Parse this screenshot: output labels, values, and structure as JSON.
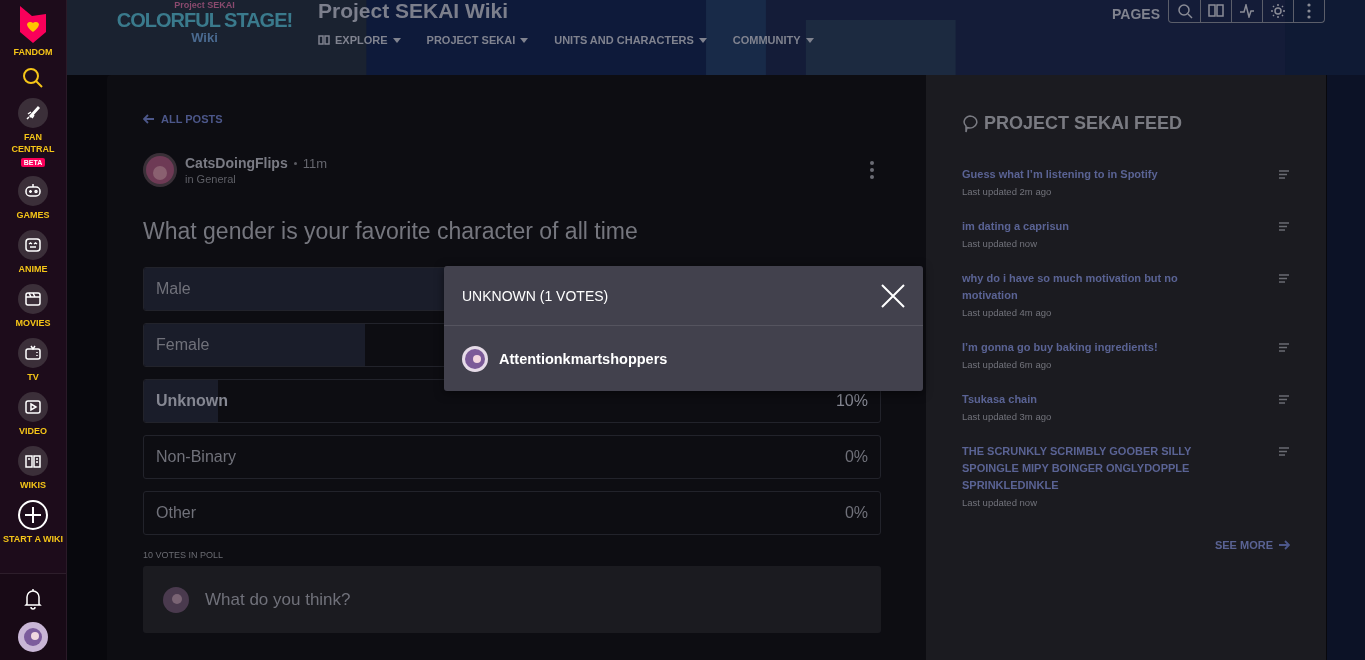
{
  "rail": {
    "brand": "FANDOM",
    "items": [
      {
        "kind": "search"
      },
      {
        "kind": "rocket",
        "label": "FAN CENTRAL",
        "badge": "BETA"
      },
      {
        "kind": "gamepad",
        "label": "GAMES"
      },
      {
        "kind": "anime",
        "label": "ANIME"
      },
      {
        "kind": "clapper",
        "label": "MOVIES"
      },
      {
        "kind": "tv",
        "label": "TV"
      },
      {
        "kind": "play",
        "label": "VIDEO"
      },
      {
        "kind": "book",
        "label": "WIKIS"
      },
      {
        "kind": "plus",
        "label": "START A WIKI"
      }
    ]
  },
  "header": {
    "logo": {
      "small": "Project SEKAI",
      "main": "COLORFUL STAGE!",
      "sub": "Wiki"
    },
    "title": "Project SEKAI Wiki",
    "nav": [
      {
        "kind": "book",
        "label": "EXPLORE"
      },
      {
        "label": "PROJECT SEKAI"
      },
      {
        "label": "UNITS AND CHARACTERS"
      },
      {
        "label": "COMMUNITY"
      }
    ],
    "pages": "PAGES",
    "tools": [
      {
        "kind": "search"
      },
      {
        "kind": "book"
      },
      {
        "kind": "activity"
      },
      {
        "kind": "sun"
      },
      {
        "kind": "more"
      }
    ]
  },
  "post": {
    "back": "ALL POSTS",
    "author": "CatsDoingFlips",
    "time": "11m",
    "category": "in General",
    "question": "What gender is your favorite character of all time",
    "options": [
      {
        "label": "Male",
        "level": 0.6,
        "selected": false
      },
      {
        "label": "Female",
        "level": 0.3,
        "selected": false
      },
      {
        "label": "Unknown",
        "level": 0.1,
        "percent": "10%",
        "selected": true
      },
      {
        "label": "Non-Binary",
        "percent": "0%",
        "selected": false
      },
      {
        "label": "Other",
        "percent": "0%",
        "selected": false
      }
    ],
    "votes": "10 VOTES IN POLL",
    "reply_placeholder": "What do you think?"
  },
  "feed": {
    "title": "PROJECT SEKAI FEED",
    "items": [
      {
        "title": "Guess what I’m listening to in Spotify",
        "meta": "Last updated 2m ago"
      },
      {
        "title": "im dating a caprisun",
        "meta": "Last updated now"
      },
      {
        "title": "why do i have so much motivation but no motivation",
        "meta": "Last updated 4m ago"
      },
      {
        "title": "I’m gonna go buy baking ingredients!",
        "meta": "Last updated 6m ago"
      },
      {
        "title": "Tsukasa chain",
        "meta": "Last updated 3m ago"
      },
      {
        "title": "THE SCRUNKLY SCRIMBLY GOOBER SILLY SPOINGLE MIPY BOINGER ONGLYDOPPLE SPRINKLEDINKLE",
        "meta": "Last updated now"
      }
    ],
    "more": "SEE MORE"
  },
  "modal": {
    "title": "UNKNOWN (1 VOTES)",
    "voters": [
      "Attentionkmartshoppers"
    ]
  }
}
